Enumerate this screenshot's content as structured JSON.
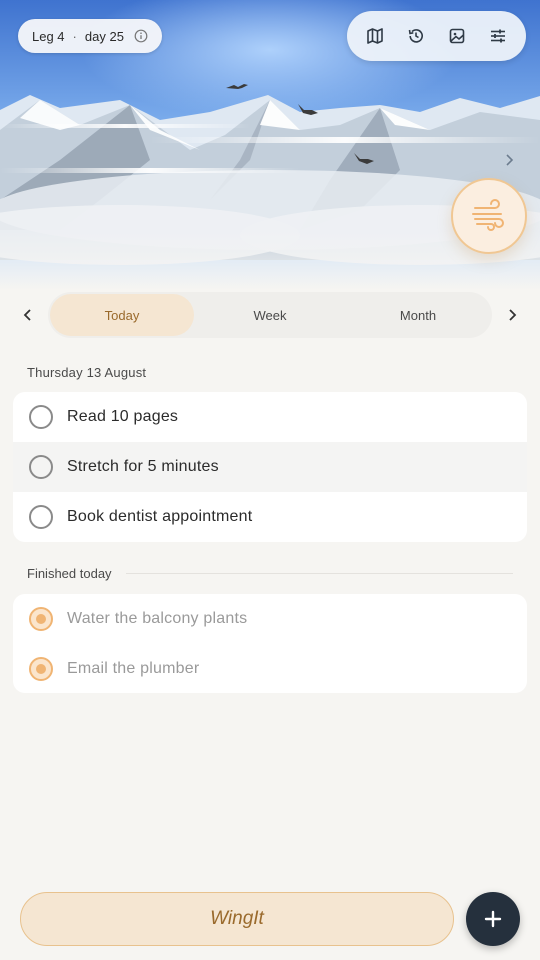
{
  "hero": {
    "leg_label": "Leg 4",
    "separator": "·",
    "day_label": "day 25",
    "toolbar_icons": [
      "map-icon",
      "history-icon",
      "image-icon",
      "sliders-icon"
    ],
    "wind_icon": "wind-icon"
  },
  "tabs": {
    "items": [
      "Today",
      "Week",
      "Month"
    ],
    "active": "Today"
  },
  "today": {
    "heading": "Thursday 13 August",
    "tasks": [
      "Read 10 pages",
      "Stretch for 5 minutes",
      "Book dentist appointment"
    ]
  },
  "finished": {
    "heading": "Finished today",
    "tasks": [
      "Water the balcony plants",
      "Email the plumber"
    ]
  },
  "bottom": {
    "wingit_label": "WingIt",
    "add_icon": "plus-icon"
  },
  "colors": {
    "accent": "#f0b473",
    "accent_light": "#f5e6d2",
    "accent_text": "#9a6a2c",
    "fab": "#25303d",
    "sky": "#4a7fd4"
  }
}
